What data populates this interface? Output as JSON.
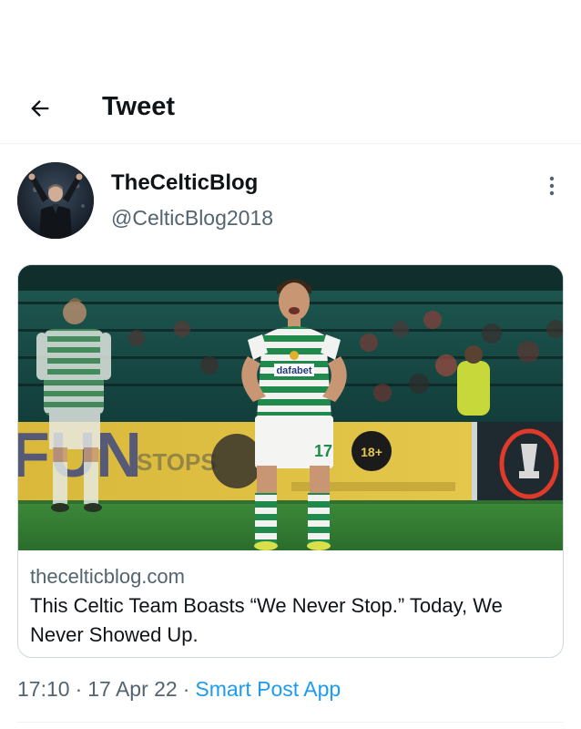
{
  "header": {
    "title": "Tweet",
    "back_icon": "arrow-left-icon"
  },
  "author": {
    "display_name": "TheCelticBlog",
    "handle": "@CelticBlog2018",
    "more_icon": "vertical-dots-icon"
  },
  "card": {
    "domain": "thecelticblog.com",
    "title": "This Celtic Team Boasts “We Never Stop.” Today, We Never Showed Up.",
    "image": {
      "jersey_text": "dafabet",
      "shirt_number": "17",
      "board_text_left": "STOPS",
      "board_badge": "18+"
    }
  },
  "meta": {
    "time": "17:10",
    "date": "17 Apr 22",
    "separator": "·",
    "source": "Smart Post App"
  },
  "colors": {
    "text": "#0f1419",
    "secondary": "#536471",
    "link": "#1d9bf0",
    "border": "#cfd9de"
  }
}
